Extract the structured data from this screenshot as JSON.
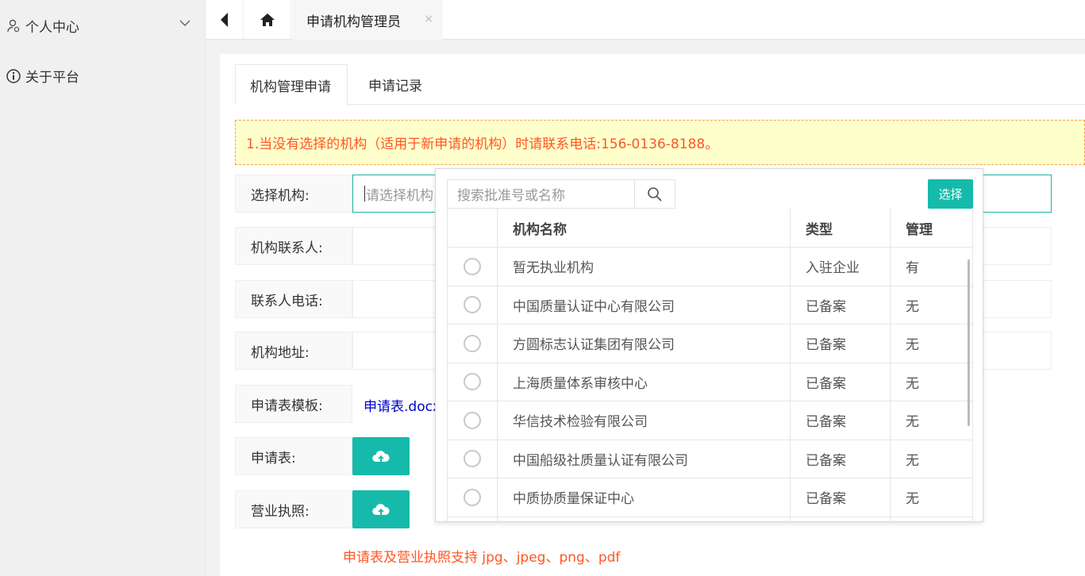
{
  "sidebar": {
    "items": [
      {
        "label": "个人中心"
      },
      {
        "label": "关于平台"
      }
    ]
  },
  "topbar": {
    "tab_label": "申请机构管理员",
    "close": "×"
  },
  "tabs": [
    "机构管理申请",
    "申请记录"
  ],
  "notice": "1.当没有选择的机构（适用于新申请的机构）时请联系电话:156-0136-8188。",
  "form": {
    "select_org_label": "选择机构:",
    "select_org_placeholder": "请选择机构",
    "contact_label": "机构联系人:",
    "phone_label": "联系人电话:",
    "address_label": "机构地址:",
    "template_label": "申请表模板:",
    "template_link": "申请表.docx",
    "application_label": "申请表:",
    "license_label": "营业执照:",
    "hint": "申请表及营业执照支持 jpg、jpeg、png、pdf"
  },
  "dropdown": {
    "search_placeholder": "搜索批准号或名称",
    "select_button": "选择",
    "columns": [
      "机构名称",
      "类型",
      "管理"
    ],
    "rows": [
      {
        "name": "暂无执业机构",
        "type": "入驻企业",
        "manage": "有"
      },
      {
        "name": "中国质量认证中心有限公司",
        "type": "已备案",
        "manage": "无"
      },
      {
        "name": "方圆标志认证集团有限公司",
        "type": "已备案",
        "manage": "无"
      },
      {
        "name": "上海质量体系审核中心",
        "type": "已备案",
        "manage": "无"
      },
      {
        "name": "华信技术检验有限公司",
        "type": "已备案",
        "manage": "无"
      },
      {
        "name": "中国船级社质量认证有限公司",
        "type": "已备案",
        "manage": "无"
      },
      {
        "name": "中质协质量保证中心",
        "type": "已备案",
        "manage": "无"
      }
    ]
  },
  "colors": {
    "accent": "#16baaa",
    "warning": "#ff5722",
    "notice_bg": "#ffffcc",
    "link": "#0000cc"
  }
}
